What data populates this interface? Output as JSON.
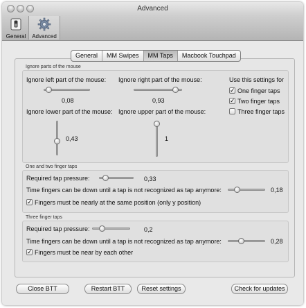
{
  "window": {
    "title": "Advanced"
  },
  "toolbar": {
    "items": [
      {
        "label": "General",
        "icon": "general-switch-icon"
      },
      {
        "label": "Advanced",
        "icon": "gear-icon"
      }
    ],
    "selected": "Advanced"
  },
  "tabs": {
    "items": [
      "General",
      "MM Swipes",
      "MM Taps",
      "Macbook Touchpad"
    ],
    "selected": "MM Taps"
  },
  "ignore_section": {
    "title": "Ignore parts of the mouse",
    "left": {
      "label": "Ignore left part of the mouse:",
      "value": "0,08",
      "level": 0.08
    },
    "right": {
      "label": "Ignore right part of the mouse:",
      "value": "0,93",
      "level": 0.93
    },
    "lower": {
      "label": "Ignore lower part of the mouse:",
      "value": "0,43",
      "level": 0.43
    },
    "upper": {
      "label": "Ignore upper part of the mouse:",
      "value": "1",
      "level": 1.0
    },
    "use_settings": {
      "label": "Use this settings for",
      "options": [
        {
          "label": "One finger taps",
          "checked": true
        },
        {
          "label": "Two finger taps",
          "checked": true
        },
        {
          "label": "Three finger taps",
          "checked": false
        }
      ]
    }
  },
  "one_two_section": {
    "title": "One and two finger taps",
    "pressure": {
      "label": "Required tap pressure:",
      "value": "0,33",
      "level": 0.33
    },
    "time": {
      "label": "Time fingers can be down until a tap is not recognized as tap anymore:",
      "value": "0,18",
      "level": 0.18
    },
    "same_position": {
      "label": "Fingers must be nearly at the same position (only y position)",
      "checked": true
    }
  },
  "three_section": {
    "title": "Three finger taps",
    "pressure": {
      "label": "Required tap pressure:",
      "value": "0,2",
      "level": 0.2
    },
    "time": {
      "label": "Time fingers can be down until a tap is not recognized as tap anymore:",
      "value": "0,28",
      "level": 0.28
    },
    "near": {
      "label": "Fingers must be near by each other",
      "checked": true
    }
  },
  "buttons": {
    "close": "Close BTT",
    "restart": "Restart BTT",
    "reset": "Reset settings",
    "updates": "Check for updates"
  }
}
